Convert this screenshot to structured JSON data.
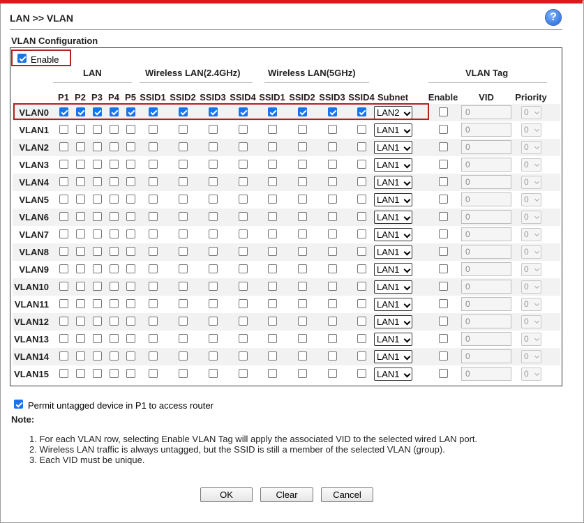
{
  "page": {
    "title": "LAN >> VLAN",
    "help_icon": "help-icon",
    "section_title": "VLAN Configuration"
  },
  "enable": {
    "label": "Enable",
    "checked": true
  },
  "headers": {
    "lan": "LAN",
    "wlan24": "Wireless LAN(2.4GHz)",
    "wlan5": "Wireless LAN(5GHz)",
    "vlan_tag": "VLAN Tag",
    "ports": [
      "P1",
      "P2",
      "P3",
      "P4",
      "P5"
    ],
    "ssid24": [
      "SSID1",
      "SSID2",
      "SSID3",
      "SSID4"
    ],
    "ssid5": [
      "SSID1",
      "SSID2",
      "SSID3",
      "SSID4"
    ],
    "subnet": "Subnet",
    "tag_enable": "Enable",
    "vid": "VID",
    "priority": "Priority"
  },
  "rows": [
    {
      "name": "VLAN0",
      "ports": [
        1,
        1,
        1,
        1,
        1
      ],
      "ssid24": [
        1,
        1,
        1,
        1
      ],
      "ssid5": [
        1,
        1,
        1,
        1
      ],
      "subnet": "LAN2",
      "tag": 0,
      "vid": "0",
      "priority": "0"
    },
    {
      "name": "VLAN1",
      "ports": [
        0,
        0,
        0,
        0,
        0
      ],
      "ssid24": [
        0,
        0,
        0,
        0
      ],
      "ssid5": [
        0,
        0,
        0,
        0
      ],
      "subnet": "LAN1",
      "tag": 0,
      "vid": "0",
      "priority": "0"
    },
    {
      "name": "VLAN2",
      "ports": [
        0,
        0,
        0,
        0,
        0
      ],
      "ssid24": [
        0,
        0,
        0,
        0
      ],
      "ssid5": [
        0,
        0,
        0,
        0
      ],
      "subnet": "LAN1",
      "tag": 0,
      "vid": "0",
      "priority": "0"
    },
    {
      "name": "VLAN3",
      "ports": [
        0,
        0,
        0,
        0,
        0
      ],
      "ssid24": [
        0,
        0,
        0,
        0
      ],
      "ssid5": [
        0,
        0,
        0,
        0
      ],
      "subnet": "LAN1",
      "tag": 0,
      "vid": "0",
      "priority": "0"
    },
    {
      "name": "VLAN4",
      "ports": [
        0,
        0,
        0,
        0,
        0
      ],
      "ssid24": [
        0,
        0,
        0,
        0
      ],
      "ssid5": [
        0,
        0,
        0,
        0
      ],
      "subnet": "LAN1",
      "tag": 0,
      "vid": "0",
      "priority": "0"
    },
    {
      "name": "VLAN5",
      "ports": [
        0,
        0,
        0,
        0,
        0
      ],
      "ssid24": [
        0,
        0,
        0,
        0
      ],
      "ssid5": [
        0,
        0,
        0,
        0
      ],
      "subnet": "LAN1",
      "tag": 0,
      "vid": "0",
      "priority": "0"
    },
    {
      "name": "VLAN6",
      "ports": [
        0,
        0,
        0,
        0,
        0
      ],
      "ssid24": [
        0,
        0,
        0,
        0
      ],
      "ssid5": [
        0,
        0,
        0,
        0
      ],
      "subnet": "LAN1",
      "tag": 0,
      "vid": "0",
      "priority": "0"
    },
    {
      "name": "VLAN7",
      "ports": [
        0,
        0,
        0,
        0,
        0
      ],
      "ssid24": [
        0,
        0,
        0,
        0
      ],
      "ssid5": [
        0,
        0,
        0,
        0
      ],
      "subnet": "LAN1",
      "tag": 0,
      "vid": "0",
      "priority": "0"
    },
    {
      "name": "VLAN8",
      "ports": [
        0,
        0,
        0,
        0,
        0
      ],
      "ssid24": [
        0,
        0,
        0,
        0
      ],
      "ssid5": [
        0,
        0,
        0,
        0
      ],
      "subnet": "LAN1",
      "tag": 0,
      "vid": "0",
      "priority": "0"
    },
    {
      "name": "VLAN9",
      "ports": [
        0,
        0,
        0,
        0,
        0
      ],
      "ssid24": [
        0,
        0,
        0,
        0
      ],
      "ssid5": [
        0,
        0,
        0,
        0
      ],
      "subnet": "LAN1",
      "tag": 0,
      "vid": "0",
      "priority": "0"
    },
    {
      "name": "VLAN10",
      "ports": [
        0,
        0,
        0,
        0,
        0
      ],
      "ssid24": [
        0,
        0,
        0,
        0
      ],
      "ssid5": [
        0,
        0,
        0,
        0
      ],
      "subnet": "LAN1",
      "tag": 0,
      "vid": "0",
      "priority": "0"
    },
    {
      "name": "VLAN11",
      "ports": [
        0,
        0,
        0,
        0,
        0
      ],
      "ssid24": [
        0,
        0,
        0,
        0
      ],
      "ssid5": [
        0,
        0,
        0,
        0
      ],
      "subnet": "LAN1",
      "tag": 0,
      "vid": "0",
      "priority": "0"
    },
    {
      "name": "VLAN12",
      "ports": [
        0,
        0,
        0,
        0,
        0
      ],
      "ssid24": [
        0,
        0,
        0,
        0
      ],
      "ssid5": [
        0,
        0,
        0,
        0
      ],
      "subnet": "LAN1",
      "tag": 0,
      "vid": "0",
      "priority": "0"
    },
    {
      "name": "VLAN13",
      "ports": [
        0,
        0,
        0,
        0,
        0
      ],
      "ssid24": [
        0,
        0,
        0,
        0
      ],
      "ssid5": [
        0,
        0,
        0,
        0
      ],
      "subnet": "LAN1",
      "tag": 0,
      "vid": "0",
      "priority": "0"
    },
    {
      "name": "VLAN14",
      "ports": [
        0,
        0,
        0,
        0,
        0
      ],
      "ssid24": [
        0,
        0,
        0,
        0
      ],
      "ssid5": [
        0,
        0,
        0,
        0
      ],
      "subnet": "LAN1",
      "tag": 0,
      "vid": "0",
      "priority": "0"
    },
    {
      "name": "VLAN15",
      "ports": [
        0,
        0,
        0,
        0,
        0
      ],
      "ssid24": [
        0,
        0,
        0,
        0
      ],
      "ssid5": [
        0,
        0,
        0,
        0
      ],
      "subnet": "LAN1",
      "tag": 0,
      "vid": "0",
      "priority": "0"
    }
  ],
  "permit": {
    "label": "Permit untagged device in P1 to access router",
    "checked": true
  },
  "note": {
    "title": "Note:",
    "items": [
      "1. For each VLAN row, selecting Enable VLAN Tag will apply the associated VID to the selected wired LAN port.",
      "2. Wireless LAN traffic is always untagged, but the SSID is still a member of the selected VLAN (group).",
      "3. Each VID must be unique."
    ]
  },
  "buttons": {
    "ok": "OK",
    "clear": "Clear",
    "cancel": "Cancel"
  },
  "colors": {
    "accent_red": "#d81b1b",
    "highlight_border": "#b32020",
    "checkbox_blue": "#1a73e8"
  }
}
